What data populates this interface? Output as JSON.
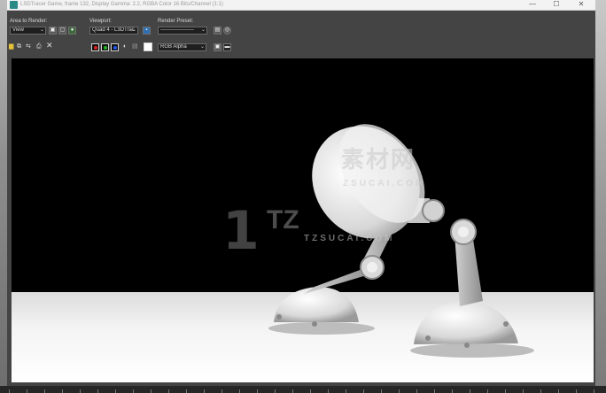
{
  "window": {
    "title": "LSDTracer Game, frame 132, Display Gamma: 2.2, RGBA Color 16 Bits/Channel (1:1)",
    "minimize_glyph": "—",
    "maximize_glyph": "☐",
    "close_glyph": "✕"
  },
  "toolbar": {
    "area_label": "Area to Render:",
    "area_value": "View",
    "viewport_label": "Viewport:",
    "viewport_value": "Quad 4 - L3DTrac",
    "preset_label": "Render Preset:",
    "preset_value": "-------------------",
    "channel_value": "RGB Alpha",
    "chevron": "⌄"
  },
  "watermark": {
    "cn": "素材网",
    "domain": "ZSUCAI.COM",
    "logo_text": "TZ",
    "logo_domain": "TZSUCAI.COM"
  },
  "colors": {
    "red_channel": "#e02020",
    "green_channel": "#22b422",
    "blue_channel": "#2255ee"
  }
}
